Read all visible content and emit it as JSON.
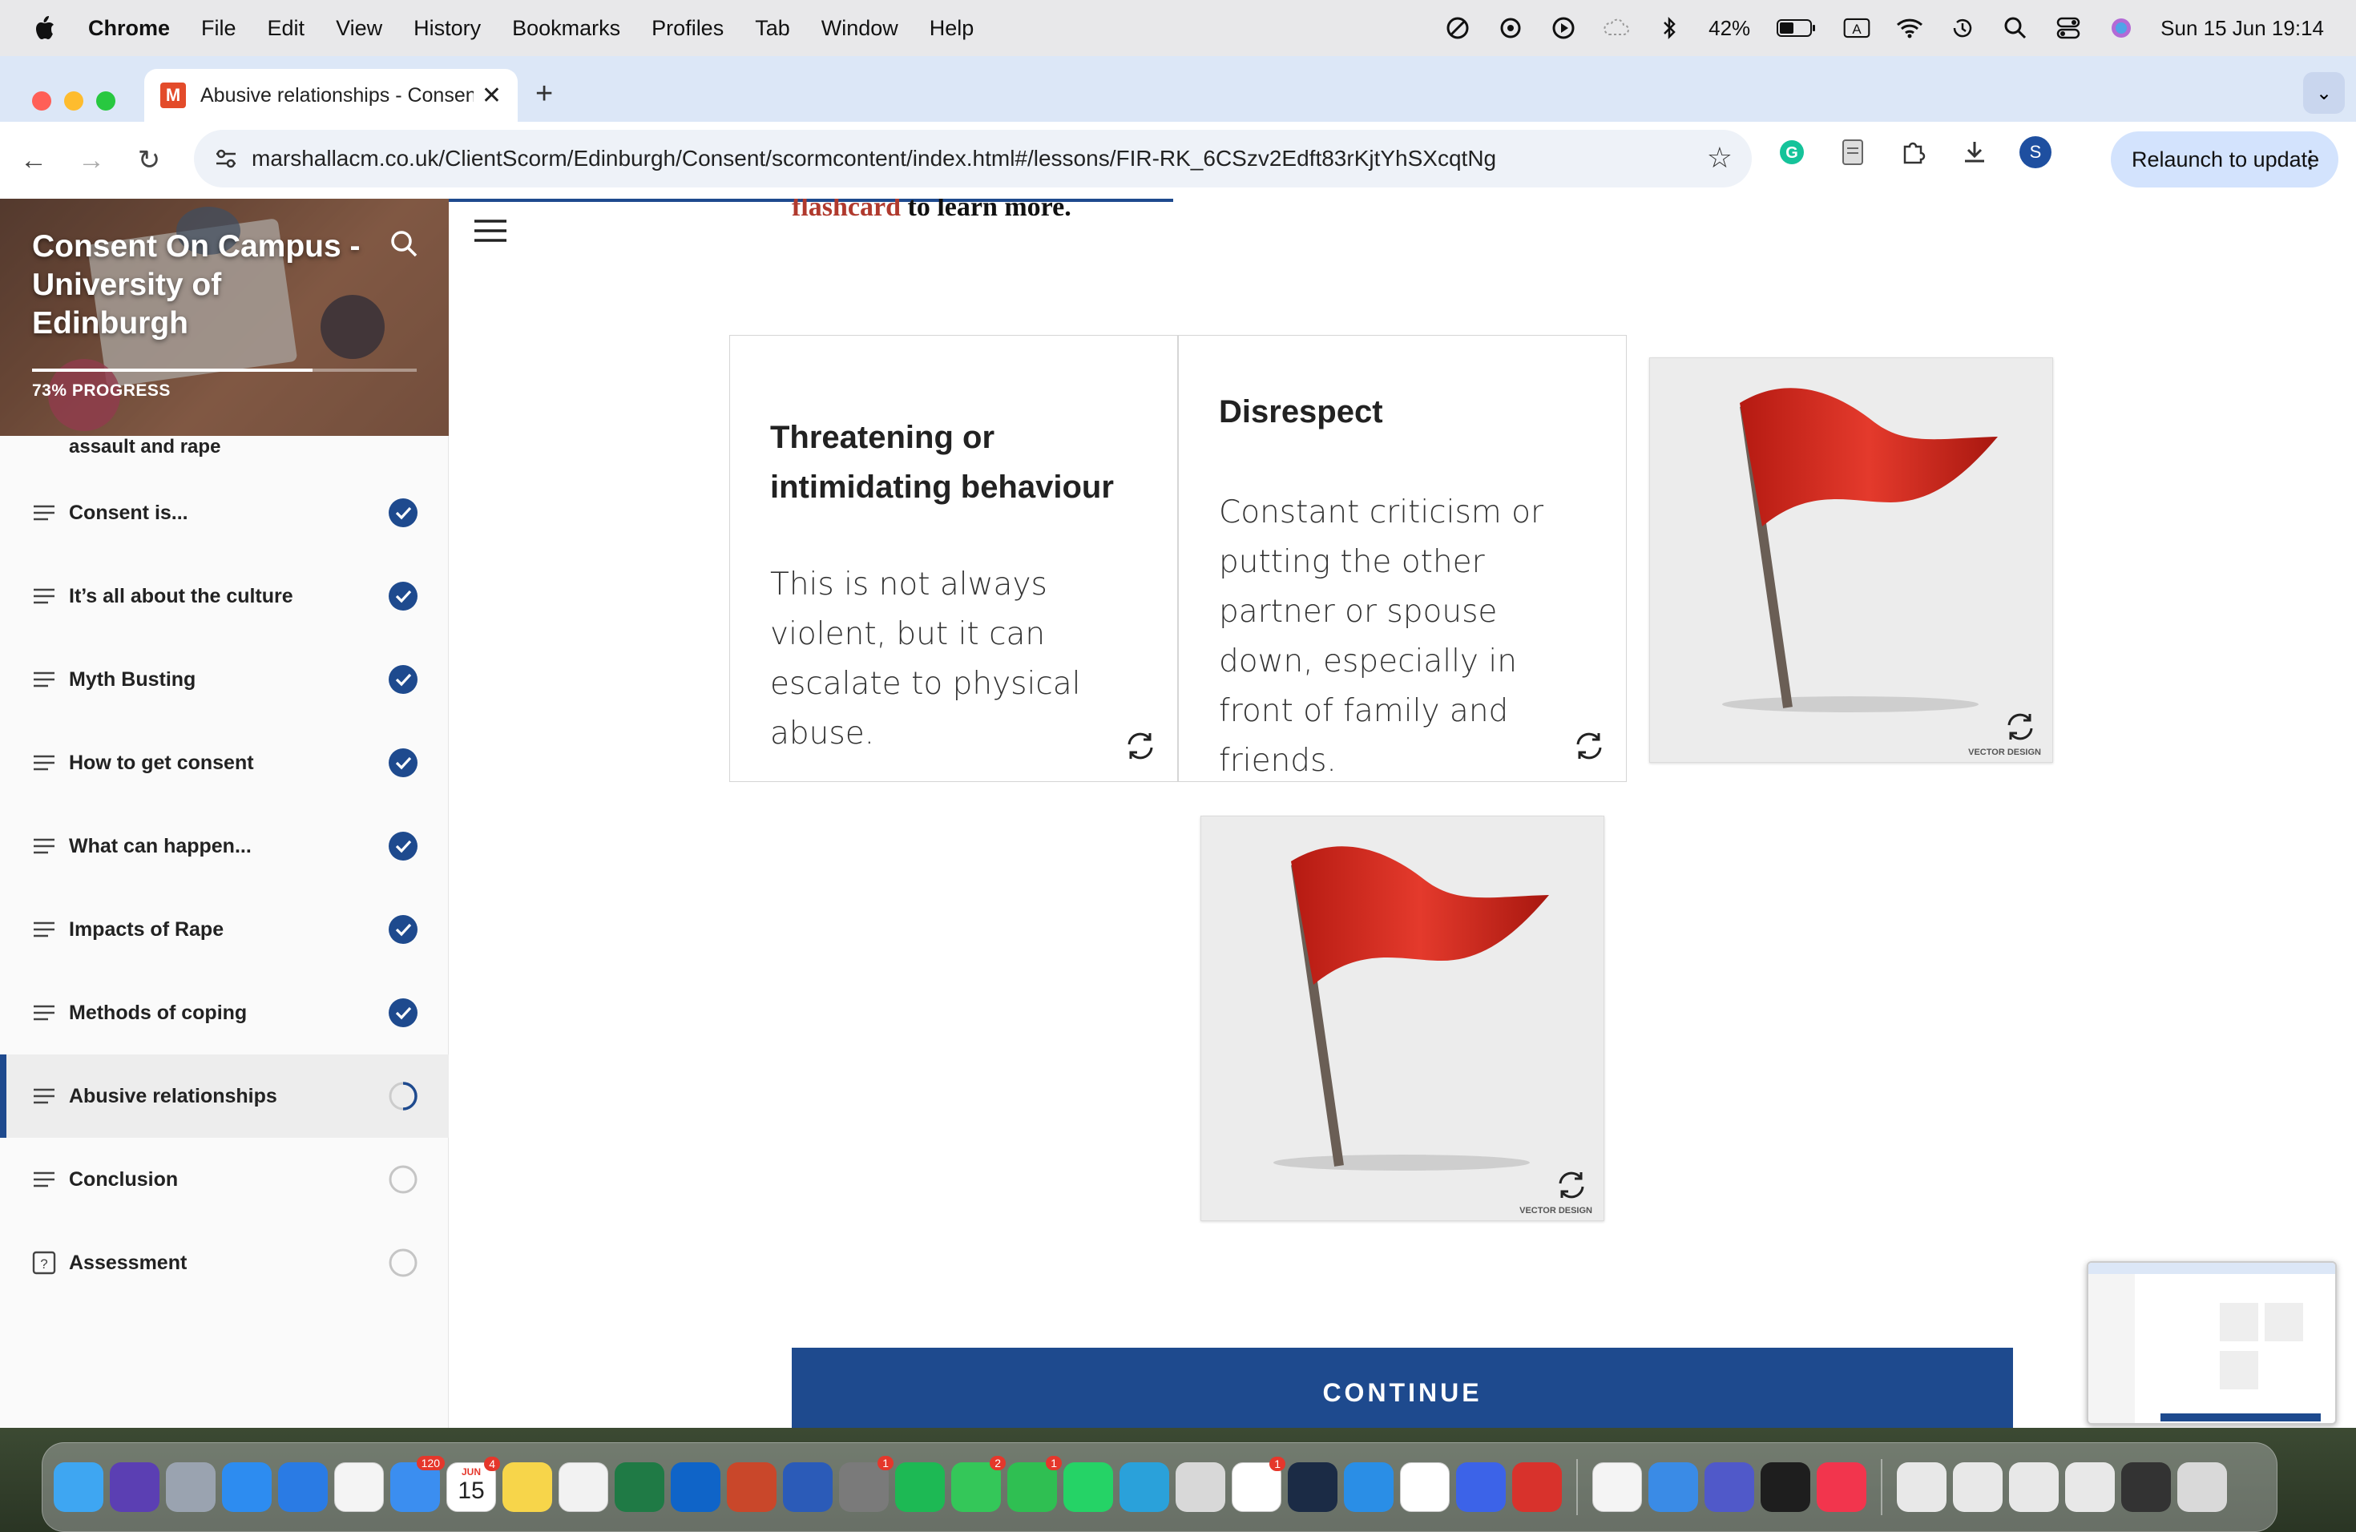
{
  "menubar": {
    "app": "Chrome",
    "items": [
      "File",
      "Edit",
      "View",
      "History",
      "Bookmarks",
      "Profiles",
      "Tab",
      "Window",
      "Help"
    ],
    "battery": "42%",
    "datetime": "Sun 15 Jun  19:14",
    "icons": [
      "focus-icon",
      "chatgpt-icon",
      "play-icon",
      "cloud-icon",
      "bluetooth-icon",
      "battery-icon",
      "input-a-icon",
      "wifi-icon",
      "timemachine-icon",
      "spotlight-icon",
      "control-center-icon",
      "siri-icon"
    ]
  },
  "browser": {
    "tab_title": "Abusive relationships - Consent On Campus",
    "tab_favicon": "M",
    "url": "marshallacm.co.uk/ClientScorm/Edinburgh/Consent/scormcontent/index.html#/lessons/FIR-RK_6CSzv2Edft83rKjtYhSXcqtNg",
    "relaunch": "Relaunch to update",
    "profile_initial": "S"
  },
  "sidebar": {
    "course_title": "Consent On Campus - University of Edinburgh",
    "progress_text": "73% PROGRESS",
    "progress": 0.73,
    "partial_item": "assault and rape",
    "lessons": [
      {
        "label": "Consent is...",
        "status": "complete",
        "icon": "lesson-lines-icon"
      },
      {
        "label": "It’s all about the culture",
        "status": "complete",
        "icon": "lesson-lines-icon"
      },
      {
        "label": "Myth Busting",
        "status": "complete",
        "icon": "lesson-lines-icon"
      },
      {
        "label": "How to get consent",
        "status": "complete",
        "icon": "lesson-lines-icon"
      },
      {
        "label": "What can happen...",
        "status": "complete",
        "icon": "lesson-lines-icon"
      },
      {
        "label": "Impacts of Rape",
        "status": "complete",
        "icon": "lesson-lines-icon"
      },
      {
        "label": "Methods of coping",
        "status": "complete",
        "icon": "lesson-lines-icon"
      },
      {
        "label": "Abusive relationships",
        "status": "in-progress",
        "icon": "lesson-lines-icon"
      },
      {
        "label": "Conclusion",
        "status": "not-started",
        "icon": "lesson-lines-icon"
      },
      {
        "label": "Assessment",
        "status": "not-started",
        "icon": "quiz-icon"
      }
    ]
  },
  "main": {
    "intro_link": "flashcard",
    "intro_rest": " to learn more.",
    "cards": [
      {
        "title": "Threatening or intimidating behaviour",
        "body": "This is not always violent, but it can escalate to physical abuse."
      },
      {
        "title": "Disrespect",
        "body": "Constant criticism or putting the other partner or spouse down, especially in front of family and friends."
      }
    ],
    "flag_caption": "VECTOR DESIGN",
    "continue": "CONTINUE"
  },
  "colors": {
    "accent": "#1e4a8e",
    "link": "#b03a2e",
    "flag": "#d42a1f"
  },
  "dock": {
    "badges": {
      "mail": "120",
      "calendar_month": "JUN",
      "calendar_day": "15",
      "calendar_badge": "4",
      "settings": "1",
      "messages": "2",
      "facetime": "1",
      "slack": "1"
    }
  }
}
